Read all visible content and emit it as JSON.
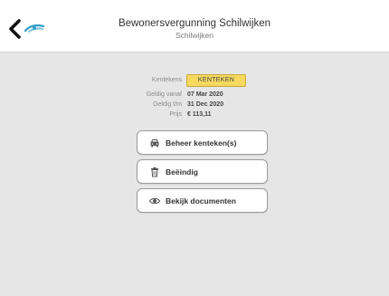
{
  "header": {
    "title": "Bewonersvergunning Schilwijken",
    "subtitle": "Schilwijken",
    "back_icon": "back-arrow-icon",
    "logo_icon": "brand-logo-icon"
  },
  "details": {
    "plate_label": "Kentekens",
    "plate_value": "KENTEKEN",
    "valid_from_label": "Geldig vanaf",
    "valid_from_value": "07 Mar 2020",
    "valid_to_label": "Geldig t/m",
    "valid_to_value": "31 Dec 2020",
    "price_label": "Prijs",
    "price_value": "€ 113,11"
  },
  "actions": {
    "manage_label": "Beheer kenteken(s)",
    "manage_icon": "car-icon",
    "end_label": "Beëindig",
    "end_icon": "trash-icon",
    "docs_label": "Bekijk documenten",
    "docs_icon": "eye-icon"
  },
  "colors": {
    "plate_bg": "#f7d960",
    "accent": "#3aa0c8",
    "background": "#e6e6e6"
  }
}
